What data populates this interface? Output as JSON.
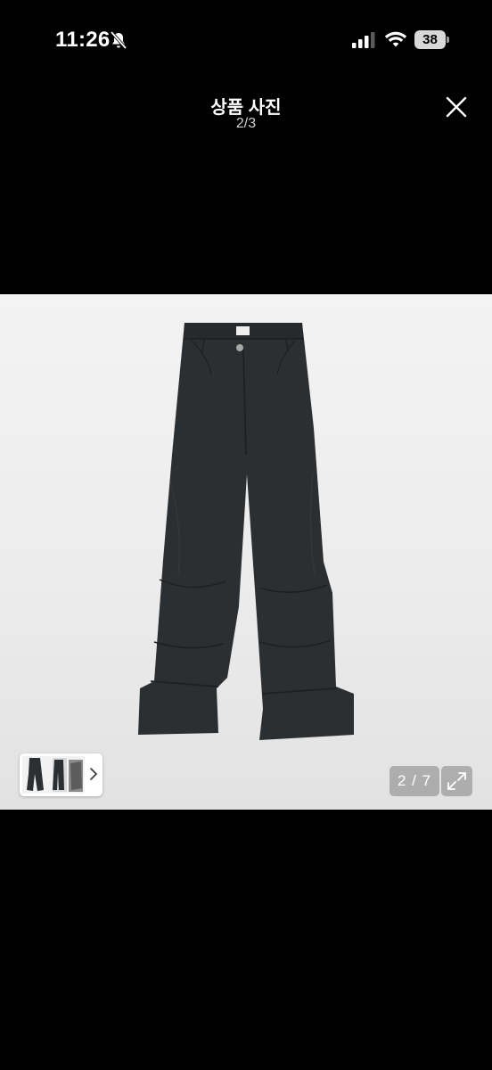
{
  "status_bar": {
    "time": "11:26",
    "battery_level": "38",
    "icons": [
      "bell-slash-icon",
      "cellular-signal-icon",
      "wifi-icon",
      "battery-icon"
    ]
  },
  "header": {
    "title": "상품 사진",
    "page_indicator": "2/3",
    "close_icon": "close-icon"
  },
  "photo": {
    "subject": "pants-image",
    "image_counter": "2 / 7",
    "expand_icon": "expand-icon",
    "thumbnail_chevron_icon": "chevron-right-icon"
  },
  "colors": {
    "background": "#000000",
    "photo_background": "#efefef",
    "garment": "#2c2f31",
    "overlay_button": "#8a8a8a"
  }
}
